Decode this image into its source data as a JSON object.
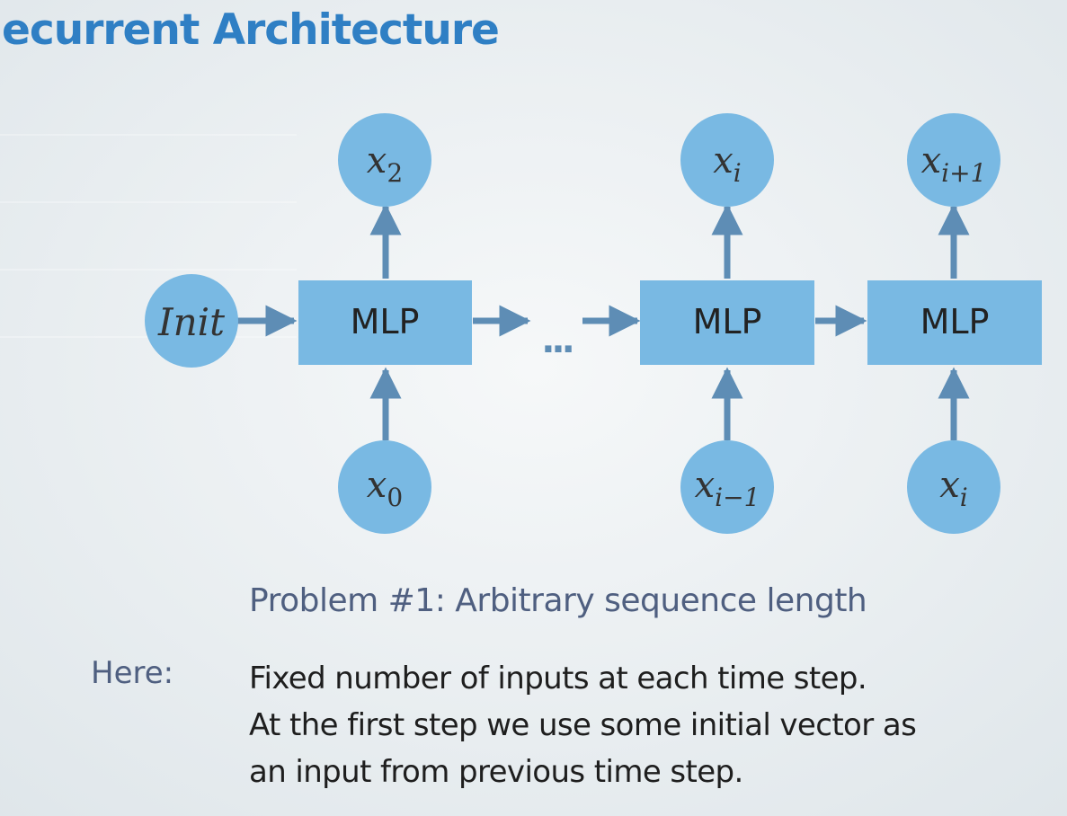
{
  "slide": {
    "title": "ecurrent Architecture"
  },
  "diagram": {
    "init_label": "Init",
    "block_label": "MLP",
    "ellipsis": "...",
    "outputs": [
      {
        "base": "x",
        "sub": "2"
      },
      {
        "base": "x",
        "sub": "i"
      },
      {
        "base": "x",
        "sub": "i+1"
      }
    ],
    "inputs": [
      {
        "base": "x",
        "sub": "0"
      },
      {
        "base": "x",
        "sub": "i−1"
      },
      {
        "base": "x",
        "sub": "i"
      }
    ]
  },
  "problem": "Problem #1: Arbitrary sequence length",
  "note": {
    "label": "Here:",
    "lines": [
      "Fixed number of inputs at each time step.",
      "At the first step we use some initial vector as",
      "an input from previous time step."
    ]
  },
  "colors": {
    "title": "#2f7fc4",
    "node_fill": "#79b9e3",
    "arrow": "#5e8db5",
    "body_text": "#1e1e1e",
    "muted_text": "#4f5f80",
    "background": "#e9eef1"
  }
}
